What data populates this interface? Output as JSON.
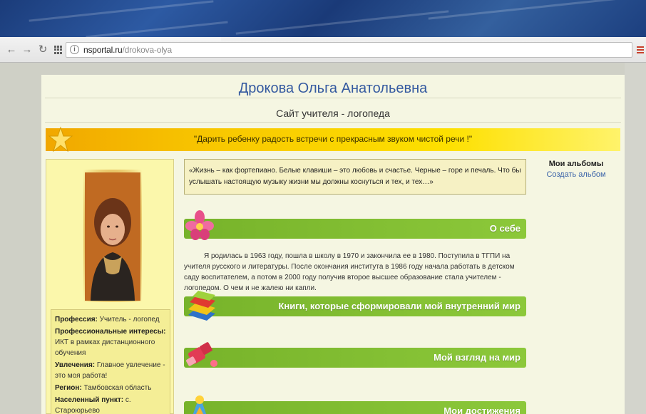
{
  "browser": {
    "url_host": "nsportal.ru",
    "url_path": "/drokova-olya",
    "site_icon_glyph": "i"
  },
  "header": {
    "name": "Дрокова Ольга Анатольевна",
    "subtitle": "Сайт учителя - логопеда"
  },
  "motto": "\"Дарить ребенку радость встречи с прекрасным звуком чистой речи !\"",
  "quote": "«Жизнь – как фортепиано. Белые клавиши – это любовь и счастье. Черные – горе и печаль. Что бы услышать настоящую музыку жизни мы должны коснуться и тех, и тех…»",
  "albums": {
    "title": "Мои альбомы",
    "create_link": "Создать альбом"
  },
  "sections": [
    {
      "label": "О себе",
      "icon": "flower-icon"
    },
    {
      "label": "Книги, которые сформировали мой внутренний мир",
      "icon": "books-icon"
    },
    {
      "label": "Мой взгляд на мир",
      "icon": "lipstick-icon"
    },
    {
      "label": "Мои достижения",
      "icon": "achievement-icon"
    }
  ],
  "about_text": "Я родилась в 1963 году, пошла  в школу в 1970 и закончила ее в 1980. Поступила в ТГПИ на учителя русского и литературы. После окончания института в 1986 году начала работать в детском саду воспитателем, а потом в 2000 году получив второе высшее образование стала учителем - логопедом. О чем и не жалею ни капли.",
  "profile": {
    "profession_label": "Профессия:",
    "profession_value": "Учитель - логопед",
    "interests_label": "Профессиональные интересы:",
    "interests_value": "ИКТ в рамках дистанционного обучения",
    "hobbies_label": "Увлечения:",
    "hobbies_value": "Главное увлечение - это моя работа!",
    "region_label": "Регион:",
    "region_value": "Тамбовская область",
    "locality_label": "Населенный пункт:",
    "locality_value": "с. Староюрьево"
  },
  "colors": {
    "title_blue": "#355aa0",
    "section_green": "#8cc83a",
    "motto_yellow": "#fde000",
    "profile_yellow": "#fbf7ab"
  }
}
